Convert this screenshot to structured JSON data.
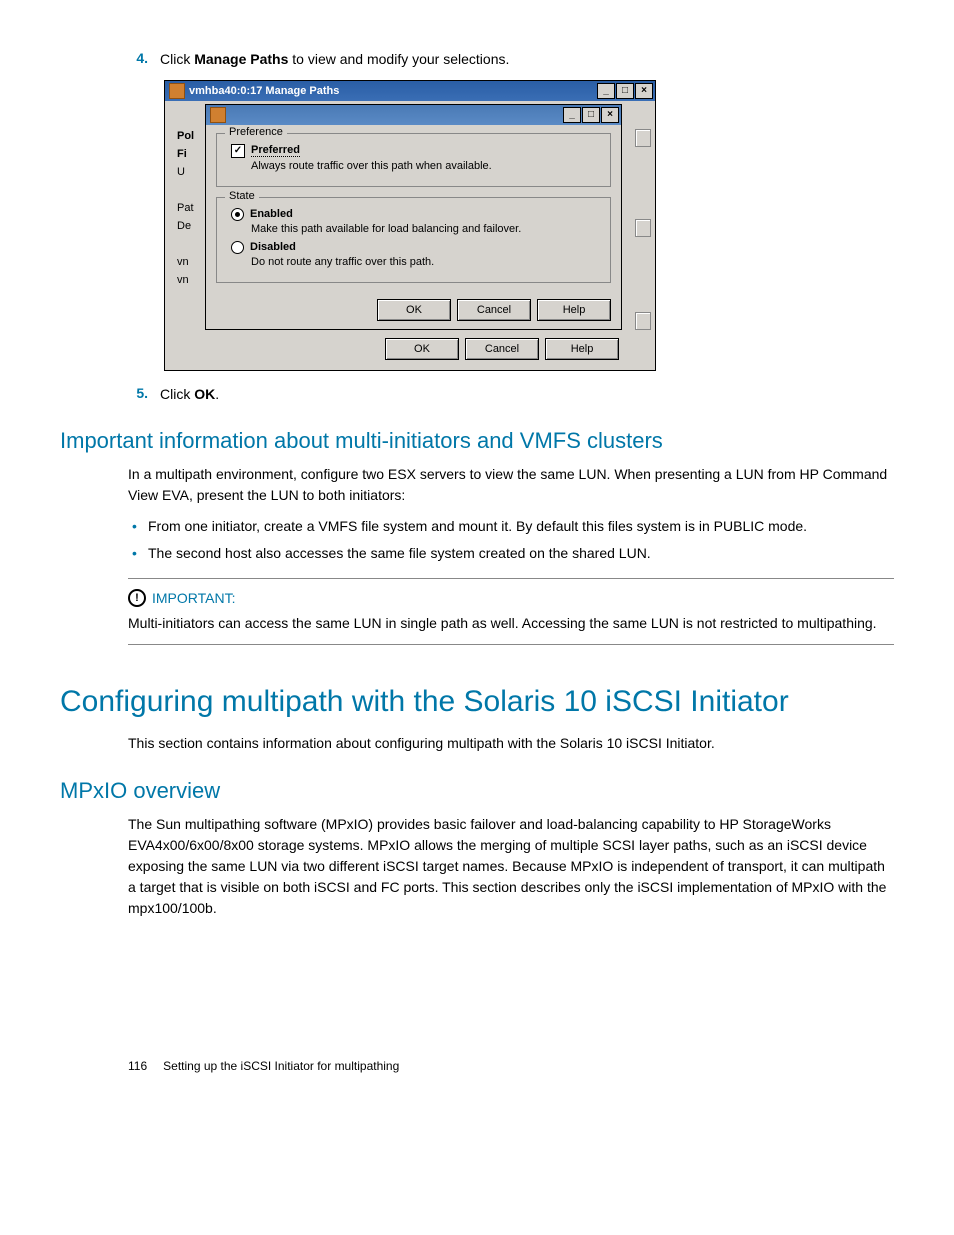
{
  "step4": {
    "num": "4.",
    "pre": "Click ",
    "bold": "Manage Paths",
    "post": " to view and modify your selections."
  },
  "dialog1": {
    "title": "vmhba40:0:17 Manage Paths",
    "fragments": {
      "a": "Pol",
      "b": "Fi",
      "c": "U",
      "d": "Pat",
      "e": "De",
      "f": "vn",
      "g": "vn"
    },
    "buttons": {
      "ok": "OK",
      "cancel": "Cancel",
      "help": "Help"
    }
  },
  "dialog2": {
    "pref": {
      "legend": "Preference",
      "chk_label": "Preferred",
      "chk_desc": "Always route traffic over this path when available."
    },
    "state": {
      "legend": "State",
      "enabled": "Enabled",
      "enabled_desc": "Make this path available for load balancing and failover.",
      "disabled": "Disabled",
      "disabled_desc": "Do not route any traffic over this path."
    },
    "buttons": {
      "ok": "OK",
      "cancel": "Cancel",
      "help": "Help"
    }
  },
  "step5": {
    "num": "5.",
    "pre": "Click ",
    "bold": "OK",
    "post": "."
  },
  "sec1": {
    "heading": "Important information about multi-initiators and VMFS clusters",
    "para": "In a multipath environment, configure two ESX servers to view the same LUN. When presenting a LUN from HP Command View EVA, present the LUN to both initiators:",
    "b1": "From one initiator, create a VMFS file system and mount it. By default this files system is in PUBLIC mode.",
    "b2": "The second host also accesses the same file system created on the shared LUN."
  },
  "callout": {
    "label": "IMPORTANT:",
    "icon": "!",
    "body": "Multi-initiators can access the same LUN in single path as well. Accessing the same LUN is not restricted to multipathing."
  },
  "sec2": {
    "heading": "Configuring multipath with the Solaris 10 iSCSI Initiator",
    "para": "This section contains information about configuring multipath with the Solaris 10 iSCSI Initiator."
  },
  "sec3": {
    "heading": "MPxIO overview",
    "para": "The Sun multipathing software (MPxIO) provides basic failover and load-balancing capability to HP StorageWorks EVA4x00/6x00/8x00 storage systems. MPxIO allows the merging of multiple SCSI layer paths, such as an iSCSI device exposing the same LUN via two different iSCSI target names. Because MPxIO is independent of transport, it can multipath a target that is visible on both iSCSI and FC ports. This section describes only the iSCSI implementation of MPxIO with the mpx100/100b."
  },
  "footer": {
    "page": "116",
    "section": "Setting up the iSCSI Initiator for multipathing"
  }
}
